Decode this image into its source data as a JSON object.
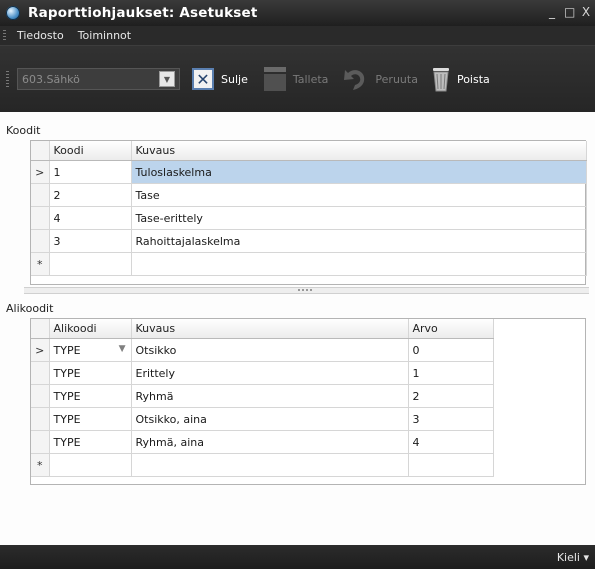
{
  "window": {
    "title": "Raporttiohjaukset: Asetukset",
    "controls": [
      "_",
      "□",
      "X"
    ]
  },
  "menu": {
    "items": [
      "Tiedosto",
      "Toiminnot"
    ]
  },
  "toolbar": {
    "combo_value": "603.Sähkö",
    "close_label": "Sulje",
    "save_label": "Talleta",
    "undo_label": "Peruuta",
    "delete_label": "Poista"
  },
  "codes": {
    "section_label": "Koodit",
    "headers": [
      "Koodi",
      "Kuvaus"
    ],
    "rows": [
      {
        "code": "1",
        "description": "Tuloslaskelma"
      },
      {
        "code": "2",
        "description": "Tase"
      },
      {
        "code": "4",
        "description": "Tase-erittely"
      },
      {
        "code": "3",
        "description": "Rahoittajalaskelma"
      }
    ],
    "new_row_marker": "*"
  },
  "subcodes": {
    "section_label": "Alikoodit",
    "headers": [
      "Alikoodi",
      "Kuvaus",
      "Arvo"
    ],
    "rows": [
      {
        "subcode": "TYPE",
        "description": "Otsikko",
        "value": "0"
      },
      {
        "subcode": "TYPE",
        "description": "Erittely",
        "value": "1"
      },
      {
        "subcode": "TYPE",
        "description": "Ryhmä",
        "value": "2"
      },
      {
        "subcode": "TYPE",
        "description": "Otsikko, aina",
        "value": "3"
      },
      {
        "subcode": "TYPE",
        "description": "Ryhmä, aina",
        "value": "4"
      }
    ],
    "new_row_marker": "*"
  },
  "row_indicator": ">",
  "status": {
    "language_label": "Kieli ▾"
  },
  "colors": {
    "selected_row": "#bcd4ec",
    "chrome_dark": "#2b2b2b",
    "close_icon_border": "#5a7fb0"
  }
}
